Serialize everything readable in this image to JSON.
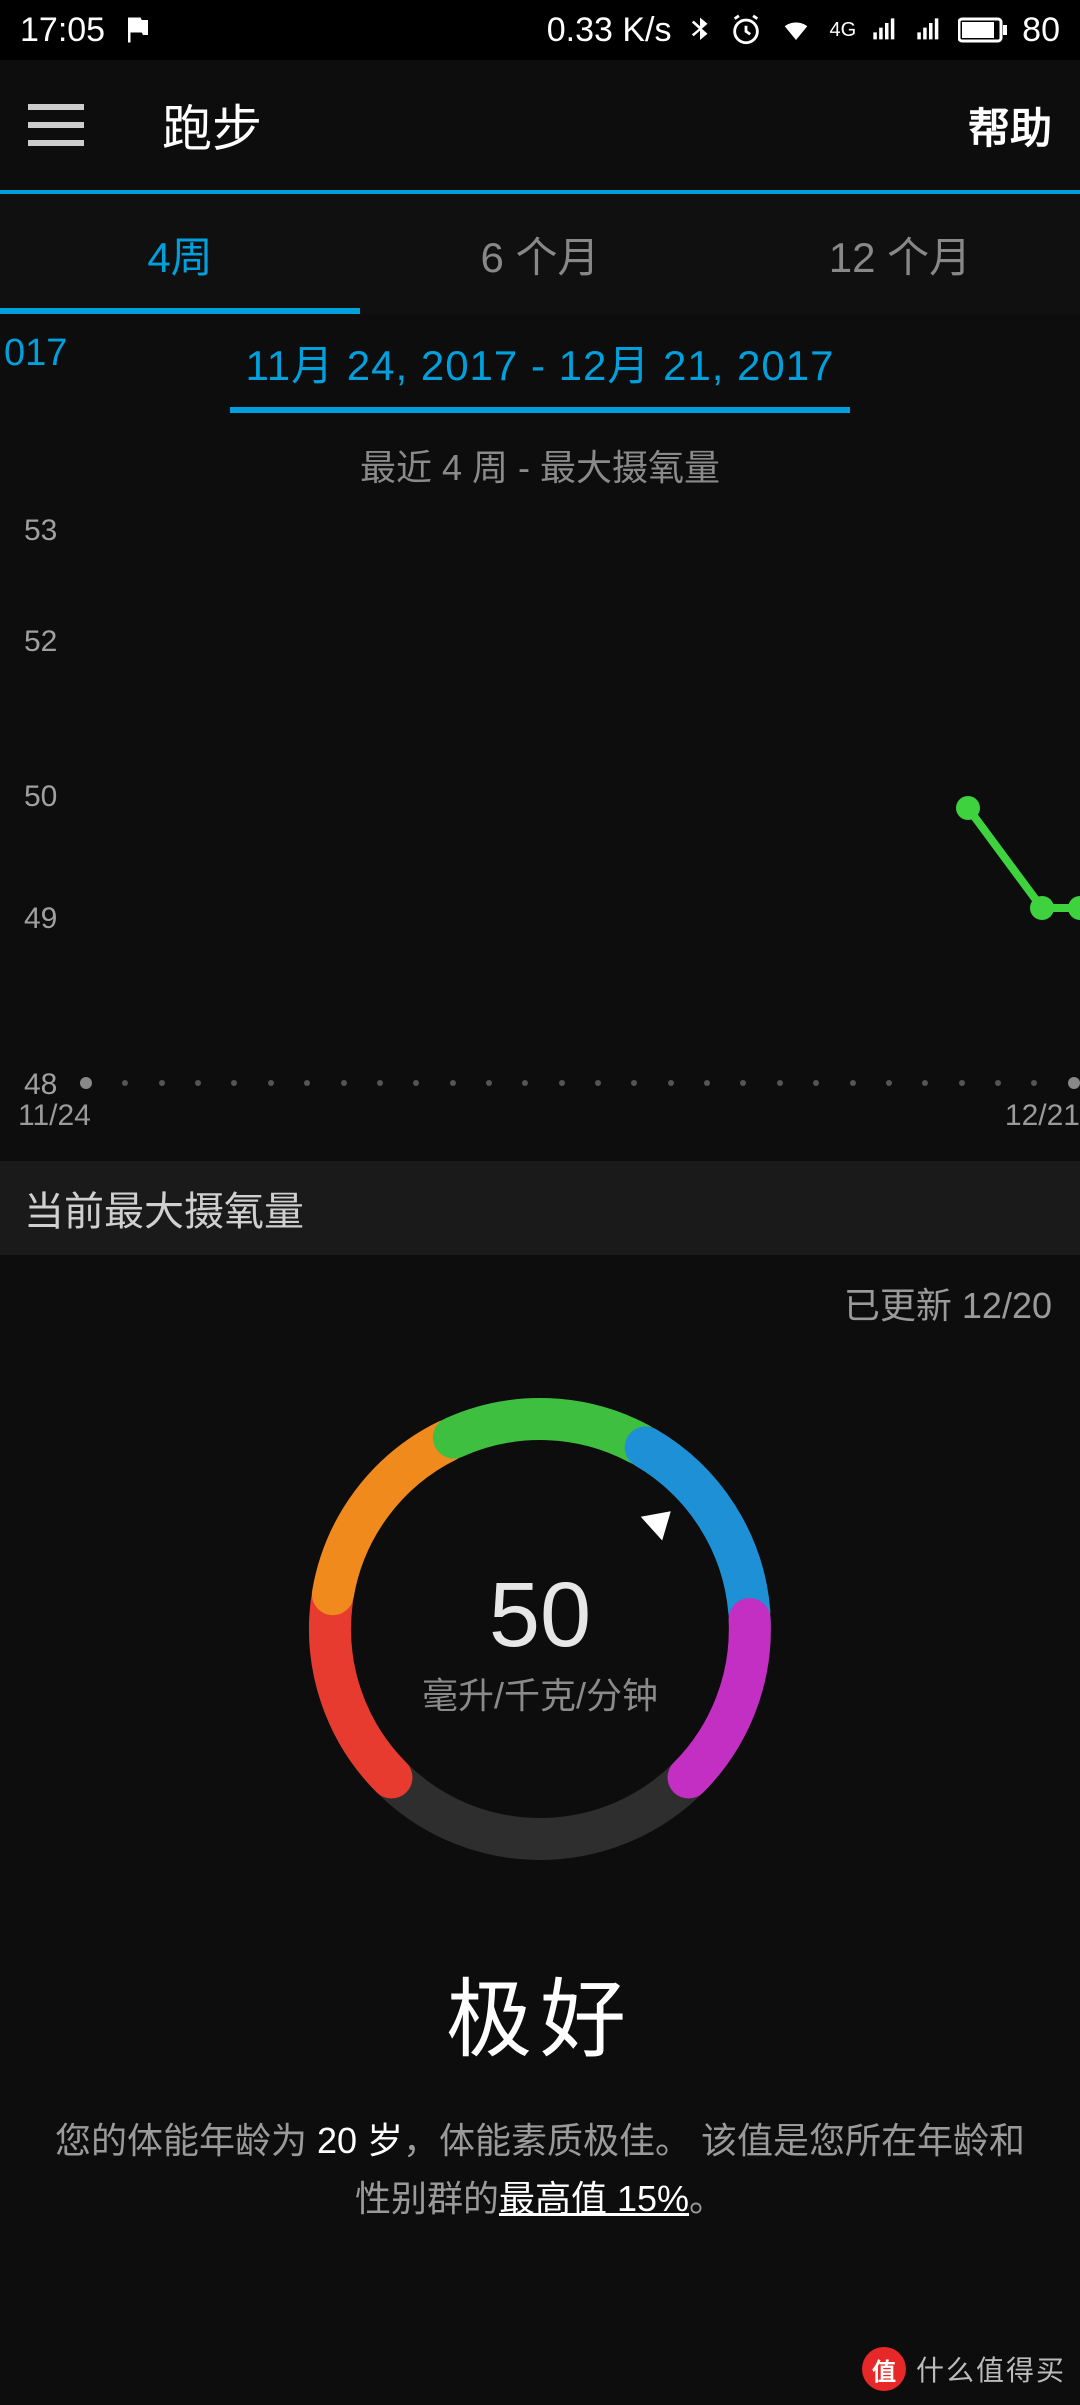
{
  "status": {
    "time": "17:05",
    "speed": "0.33 K/s",
    "battery": "80"
  },
  "appbar": {
    "title": "跑步",
    "help": "帮助"
  },
  "tabs": {
    "t1": "4周",
    "t2": "6 个月",
    "t3": "12 个月"
  },
  "range": {
    "prev": "017",
    "text": "11月 24, 2017 - 12月 21, 2017"
  },
  "subtitle": "最近 4 周 - 最大摄氧量",
  "chart_data": {
    "type": "line",
    "title": "最近 4 周 - 最大摄氧量",
    "xlabel": "",
    "ylabel": "",
    "ylim": [
      48,
      53
    ],
    "y_ticks": [
      48,
      49,
      50,
      52,
      53
    ],
    "x_range": [
      "11/24",
      "12/21"
    ],
    "series": [
      {
        "name": "VO2max",
        "color": "#3fd23f",
        "points": [
          {
            "x": "12/18",
            "y": 50.5
          },
          {
            "x": "12/20",
            "y": 49.6
          },
          {
            "x": "12/21",
            "y": 49.6
          }
        ]
      }
    ]
  },
  "y_ticks": {
    "t0": "53",
    "t1": "52",
    "t2": "50",
    "t3": "49",
    "t4": "48"
  },
  "x_labels": {
    "start": "11/24",
    "end": "12/21"
  },
  "section": {
    "header": "当前最大摄氧量",
    "updated": "已更新 12/20"
  },
  "gauge": {
    "value": "50",
    "unit": "毫升/千克/分钟",
    "segments": [
      {
        "color": "#e63b2e"
      },
      {
        "color": "#f08a1d"
      },
      {
        "color": "#3fbf3f"
      },
      {
        "color": "#1e90d6"
      },
      {
        "color": "#c22fc2"
      }
    ]
  },
  "rating": "极好",
  "description_parts": {
    "p1": "您的体能年龄为 ",
    "age": "20 岁",
    "p2": "，体能素质极佳。 该值是您所在年龄和性别群的",
    "highlight": "最高值 15%",
    "p3": "。"
  },
  "watermark": {
    "badge": "值",
    "text": "什么值得买"
  }
}
